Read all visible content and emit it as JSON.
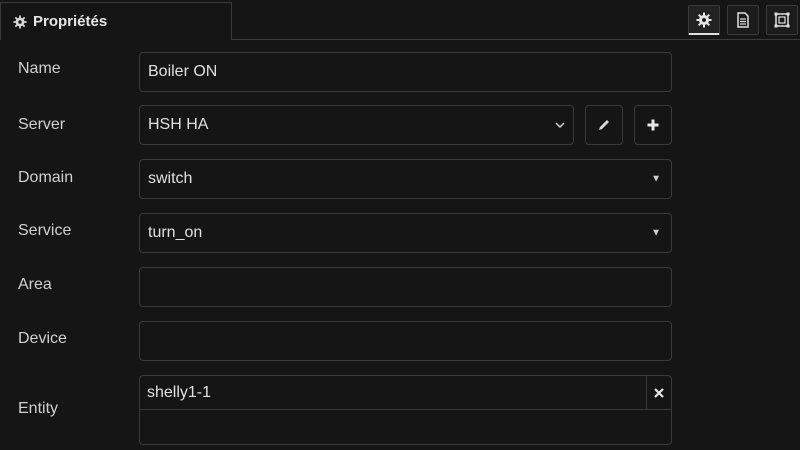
{
  "tabs": {
    "active_title": "Propriétés",
    "toolbar": [
      {
        "icon": "gear-icon",
        "active": true
      },
      {
        "icon": "document-icon",
        "active": false
      },
      {
        "icon": "frame-icon",
        "active": false
      }
    ]
  },
  "form": {
    "name": {
      "label": "Name",
      "value": "Boiler ON"
    },
    "server": {
      "label": "Server",
      "value": "HSH HA"
    },
    "domain": {
      "label": "Domain",
      "value": "switch"
    },
    "service": {
      "label": "Service",
      "value": "turn_on"
    },
    "area": {
      "label": "Area",
      "value": ""
    },
    "device": {
      "label": "Device",
      "value": ""
    },
    "entity": {
      "label": "Entity",
      "value": "shelly1-1"
    }
  },
  "colors": {
    "background": "#151515",
    "border": "#3a3a3a",
    "text": "#d4d4d4"
  }
}
